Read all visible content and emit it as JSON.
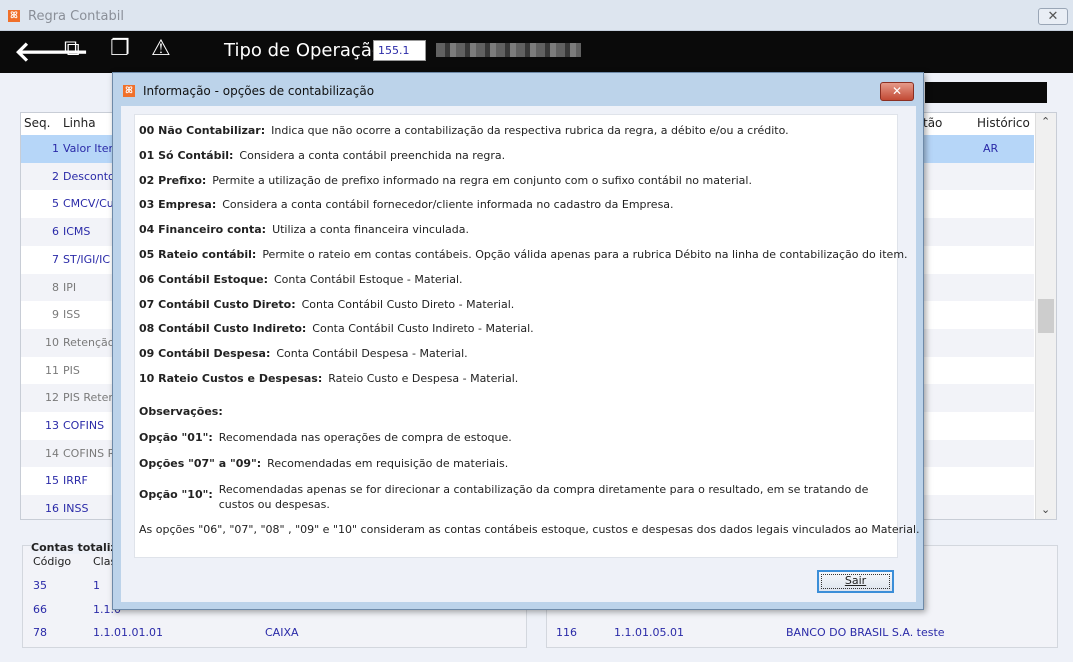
{
  "window": {
    "title": "Regra Contabil",
    "close_icon": "close-icon"
  },
  "toolbar": {
    "icons": [
      "back-arrow-icon",
      "export-icon",
      "copy-icon",
      "warning-icon"
    ],
    "tipo_label": "Tipo de Operação",
    "tipo_value": "155.1"
  },
  "grid": {
    "columns": {
      "seq": "Seq.",
      "linha": "Linha",
      "partial": "tão",
      "historico": "Histórico"
    },
    "rows": [
      {
        "seq": "1",
        "linha": "Valor Item",
        "historico": "AR",
        "active": true,
        "selected": true
      },
      {
        "seq": "2",
        "linha": "Desconto",
        "active": true
      },
      {
        "seq": "5",
        "linha": "CMCV/Cu",
        "active": true
      },
      {
        "seq": "6",
        "linha": "ICMS",
        "active": true
      },
      {
        "seq": "7",
        "linha": "ST/IGI/IC",
        "active": true
      },
      {
        "seq": "8",
        "linha": "IPI",
        "active": false
      },
      {
        "seq": "9",
        "linha": "ISS",
        "active": false
      },
      {
        "seq": "10",
        "linha": "Retenção",
        "active": false
      },
      {
        "seq": "11",
        "linha": "PIS",
        "active": false
      },
      {
        "seq": "12",
        "linha": "PIS Reter",
        "active": false
      },
      {
        "seq": "13",
        "linha": "COFINS",
        "active": true
      },
      {
        "seq": "14",
        "linha": "COFINS R",
        "active": false
      },
      {
        "seq": "15",
        "linha": "IRRF",
        "active": true
      },
      {
        "seq": "16",
        "linha": "INSS",
        "active": true
      }
    ]
  },
  "totals": {
    "title": "Contas totaliz",
    "col_codigo": "Código",
    "col_clas": "Clas",
    "left_rows": [
      {
        "codigo": "35",
        "clas": "1",
        "desc": ""
      },
      {
        "codigo": "66",
        "clas": "1.1.0",
        "desc": ""
      },
      {
        "codigo": "78",
        "clas": "1.1.01.01.01",
        "desc": "CAIXA"
      }
    ],
    "right_rows": [
      {
        "codigo": "116",
        "clas": "1.1.01.05.01",
        "desc": "BANCO DO BRASIL S.A. teste"
      }
    ]
  },
  "dialog": {
    "title": "Informação - opções de contabilização",
    "options": [
      {
        "label": "00 Não Contabilizar:",
        "text": "Indica que não ocorre a contabilização da respectiva rubrica da regra, a débito e/ou a crédito."
      },
      {
        "label": "01 Só Contábil:",
        "text": "Considera a conta contábil preenchida na regra."
      },
      {
        "label": "02 Prefixo:",
        "text": "Permite a utilização de prefixo informado na regra em conjunto com o sufixo contábil no material."
      },
      {
        "label": "03 Empresa:",
        "text": "Considera a conta contábil fornecedor/cliente informada no cadastro da Empresa."
      },
      {
        "label": "04 Financeiro conta:",
        "text": "Utiliza a conta financeira vinculada."
      },
      {
        "label": "05 Rateio contábil:",
        "text": "Permite o rateio em contas contábeis. Opção válida apenas para a rubrica Débito na linha de contabilização do item."
      },
      {
        "label": "06 Contábil Estoque:",
        "text": "Conta Contábil Estoque - Material."
      },
      {
        "label": "07 Contábil Custo Direto:",
        "text": "Conta Contábil Custo Direto - Material."
      },
      {
        "label": "08 Contábil Custo Indireto:",
        "text": "Conta Contábil Custo Indireto - Material."
      },
      {
        "label": "09 Contábil Despesa:",
        "text": "Conta Contábil Despesa - Material."
      },
      {
        "label": "10 Rateio Custos e Despesas:",
        "text": "Rateio Custo e Despesa - Material."
      }
    ],
    "obs_title": "Observações:",
    "obs": [
      {
        "label": "Opção \"01\":",
        "text": "Recomendada nas operações de compra de estoque."
      },
      {
        "label": "Opções \"07\" a \"09\":",
        "text": "Recomendadas em requisição de materiais."
      },
      {
        "label": "Opção \"10\":",
        "text": "Recomendadas apenas se for direcionar a contabilização da compra diretamente para o resultado, em se tratando de",
        "text2": "custos ou despesas."
      }
    ],
    "footer": "As opções \"06\", \"07\", \"08\" , \"09\" e \"10\" consideram as contas contábeis estoque, custos e despesas dos dados legais vinculados ao Material.",
    "sair_label": "Sair"
  }
}
